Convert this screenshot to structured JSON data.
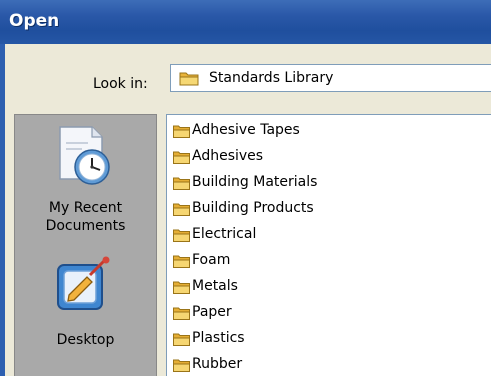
{
  "window": {
    "title": "Open"
  },
  "look_in": {
    "label": "Look in:",
    "value": "Standards Library",
    "icon": "folder-icon"
  },
  "places": [
    {
      "label": "My Recent\nDocuments",
      "icon": "recent-documents-icon"
    },
    {
      "label": "Desktop",
      "icon": "desktop-icon"
    }
  ],
  "files": [
    "Adhesive Tapes",
    "Adhesives",
    "Building Materials",
    "Building Products",
    "Electrical",
    "Foam",
    "Metals",
    "Paper",
    "Plastics",
    "Rubber"
  ],
  "colors": {
    "title_bar": "#2a58a8",
    "dialog_bg": "#ece9d8",
    "places_bg": "#a9a9a9",
    "folder_yellow": "#f3c95a"
  }
}
